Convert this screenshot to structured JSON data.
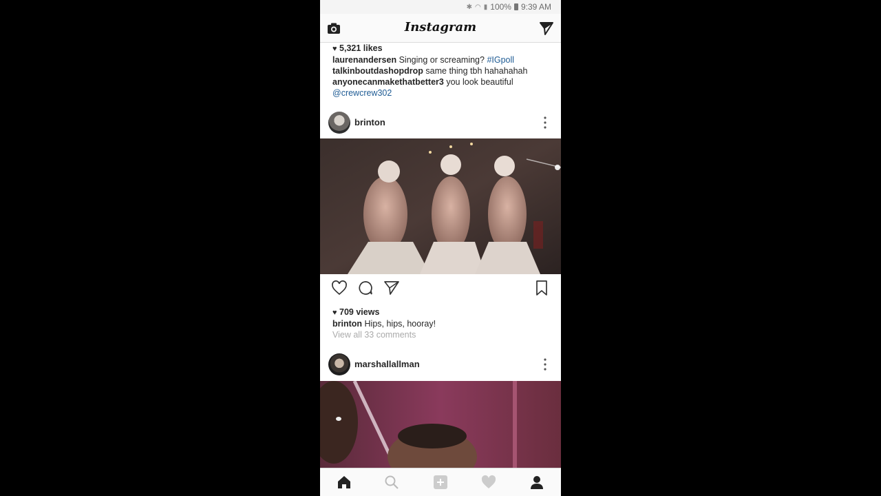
{
  "status_bar": {
    "battery": "100%",
    "time": "9:39 AM"
  },
  "top_bar": {
    "logo": "Instagram"
  },
  "previous_post": {
    "likes": "5,321 likes",
    "caption_user": "laurenandersen",
    "caption_text": "Singing or screaming?",
    "caption_hashtag": "#IGpoll",
    "comments": [
      {
        "user": "talkinboutdashopdrop",
        "text": "same thing tbh hahahahah"
      },
      {
        "user": "anyonecanmakethatbetter3",
        "text": "you look beautiful",
        "mention": "@crewcrew302"
      }
    ]
  },
  "post": {
    "username": "brinton",
    "views": "709 views",
    "caption_user": "brinton",
    "caption_text": "Hips, hips, hooray!",
    "view_comments": "View all 33 comments"
  },
  "next_post": {
    "username": "marshallallman"
  },
  "colors": {
    "link": "#1e5b94",
    "text": "#262626",
    "muted": "#aaaaaa",
    "bar": "#fafafa"
  }
}
